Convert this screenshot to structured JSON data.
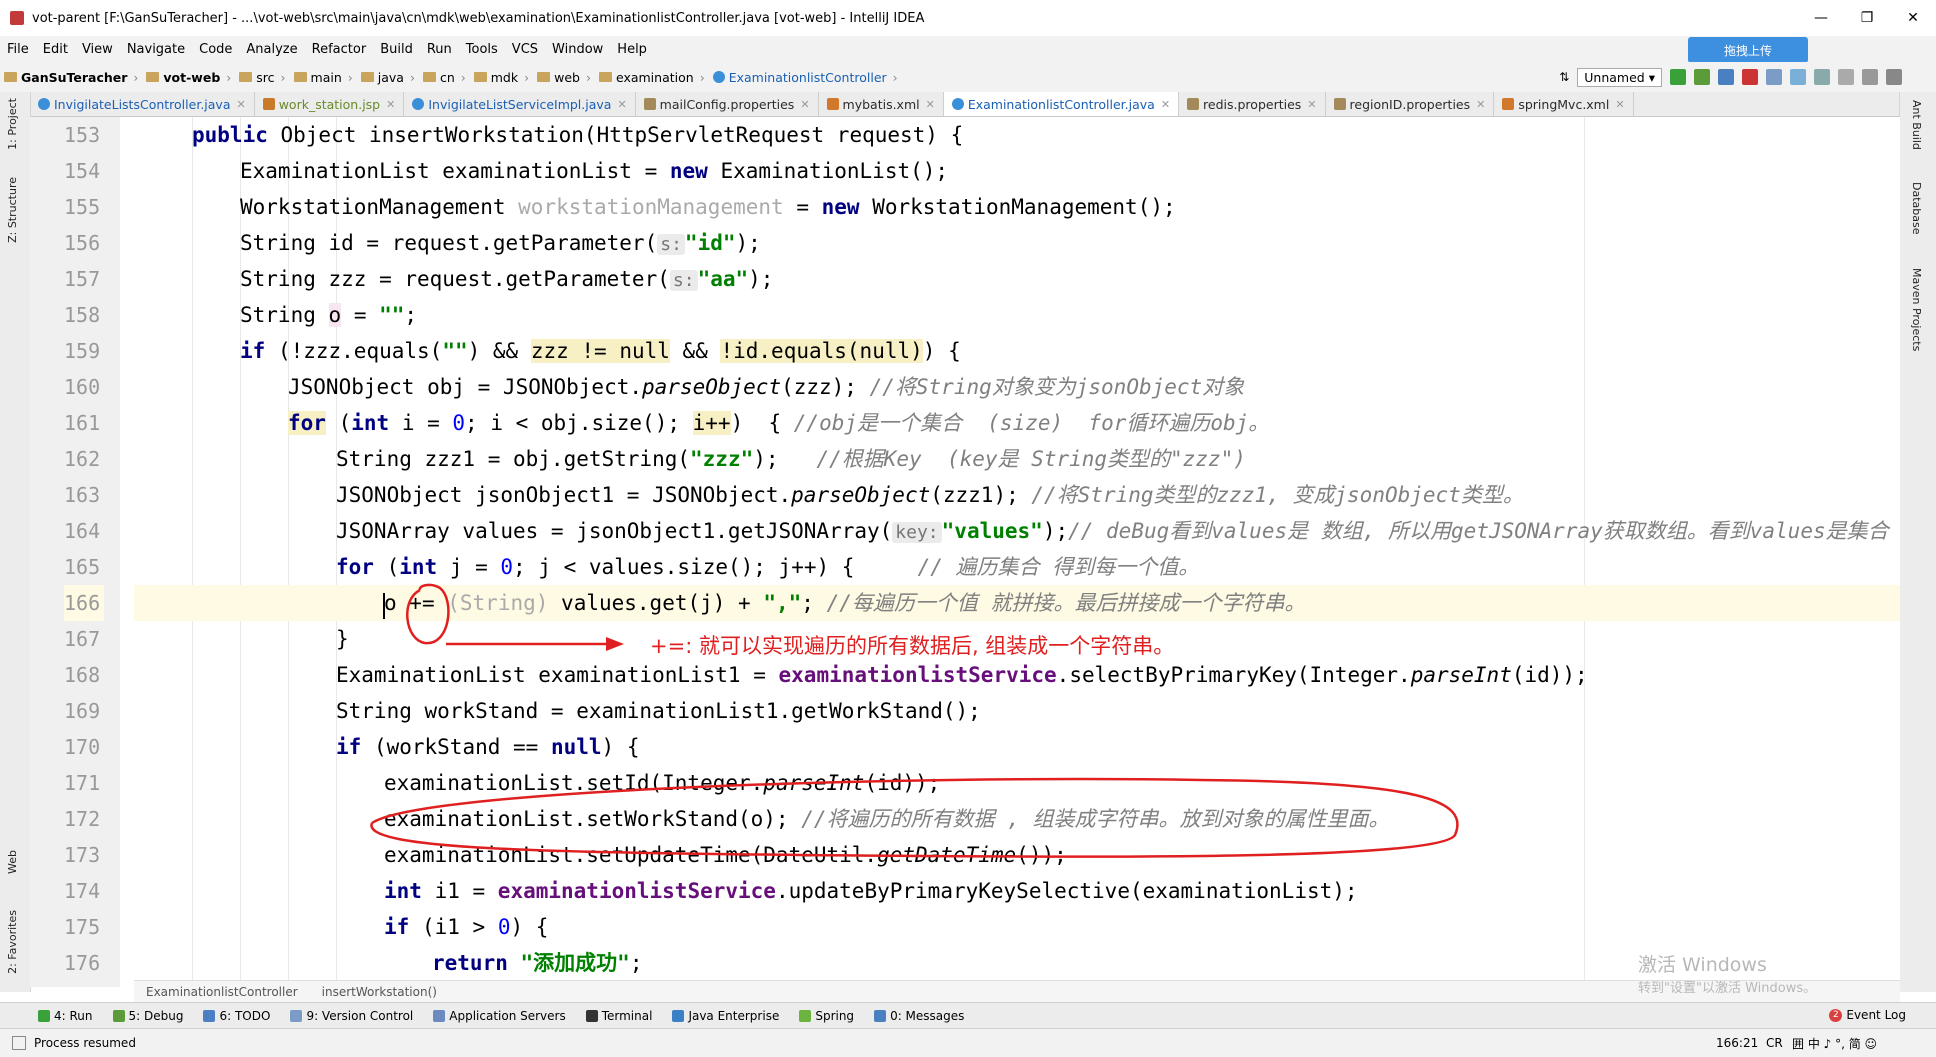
{
  "window": {
    "title": "vot-parent [F:\\GanSuTeracher] - ...\\vot-web\\src\\main\\java\\cn\\mdk\\web\\examination\\ExaminationlistController.java [vot-web] - IntelliJ IDEA",
    "min": "—",
    "max": "❐",
    "close": "✕"
  },
  "menu": [
    "File",
    "Edit",
    "View",
    "Navigate",
    "Code",
    "Analyze",
    "Refactor",
    "Build",
    "Run",
    "Tools",
    "VCS",
    "Window",
    "Help"
  ],
  "breadcrumbs": [
    "GanSuTeracher",
    "vot-web",
    "src",
    "main",
    "java",
    "cn",
    "mdk",
    "web",
    "examination",
    "ExaminationlistController"
  ],
  "run_config": "Unnamed",
  "upload_label": "拖拽上传",
  "tabs": [
    {
      "label": "InvigilateListsController.java",
      "active": false
    },
    {
      "label": "work_station.jsp",
      "active": false
    },
    {
      "label": "InvigilateListServiceImpl.java",
      "active": false
    },
    {
      "label": "mailConfig.properties",
      "active": false
    },
    {
      "label": "mybatis.xml",
      "active": false
    },
    {
      "label": "ExaminationlistController.java",
      "active": true
    },
    {
      "label": "redis.properties",
      "active": false
    },
    {
      "label": "regionID.properties",
      "active": false
    },
    {
      "label": "springMvc.xml",
      "active": false
    }
  ],
  "left_tools": [
    "1: Project",
    "Z: Structure",
    "Web",
    "2: Favorites"
  ],
  "right_tools": [
    "Ant Build",
    "Database",
    "Maven Projects"
  ],
  "code": {
    "line_numbers": [
      "153",
      "154",
      "155",
      "156",
      "157",
      "158",
      "159",
      "160",
      "161",
      "162",
      "163",
      "164",
      "165",
      "166",
      "167",
      "168",
      "169",
      "170",
      "171",
      "172",
      "173",
      "174",
      "175",
      "176"
    ],
    "l153": {
      "kw": "public",
      "rest": " Object insertWorkstation(HttpServletRequest request) {"
    },
    "l154": {
      "a": "ExaminationList examinationList = ",
      "kw": "new",
      "b": " ExaminationList();"
    },
    "l155": {
      "a": "WorkstationManagement ",
      "gray": "workstationManagement",
      "b": " = ",
      "kw": "new",
      "c": " WorkstationManagement();"
    },
    "l156": {
      "a": "String id = request.getParameter(",
      "hint": "s:",
      "str": "\"id\"",
      "b": ");"
    },
    "l157": {
      "a": "String zzz = request.getParameter(",
      "hint": "s:",
      "str": "\"aa\"",
      "b": ");"
    },
    "l158": {
      "a": "String ",
      "o": "o",
      "b": " = ",
      "str": "\"\"",
      "c": ";"
    },
    "l159": {
      "kw": "if",
      "a": " (!zzz.equals(",
      "str": "\"\"",
      "b": ") && ",
      "w1": "zzz != null",
      "c": " && ",
      "w2": "!id.equals(null)",
      "d": ") {"
    },
    "l160": {
      "a": "JSONObject obj = JSONObject.",
      "it": "parseObject",
      "b": "(zzz); ",
      "cm": "//将String对象变为jsonObject对象"
    },
    "l161": {
      "kw": "for",
      "a": " (",
      "kw2": "int",
      "b": " i = ",
      "n": "0",
      "c": "; i < obj.size(); ",
      "w": "i++",
      "d": ")  { ",
      "cm": "//obj是一个集合  (size)  for循环遍历obj。"
    },
    "l162": {
      "a": "String zzz1 = obj.getString(",
      "str": "\"zzz\"",
      "b": ");   ",
      "cm": "//根据Key  (key是 String类型的\"zzz\")"
    },
    "l163": {
      "a": "JSONObject jsonObject1 = JSONObject.",
      "it": "parseObject",
      "b": "(zzz1); ",
      "cm": "//将String类型的zzz1, 变成jsonObject类型。"
    },
    "l164": {
      "a": "JSONArray values = jsonObject1.getJSONArray(",
      "hint": "key:",
      "str": "\"values\"",
      "b": ");",
      "cm": "// deBug看到values是 数组, 所以用getJSONArray获取数组。看到values是集合"
    },
    "l165": {
      "kw": "for",
      "a": " (",
      "kw2": "int",
      "b": " j = ",
      "n": "0",
      "c": "; j < values.size(); j++) {     ",
      "cm": "// 遍历集合 得到每一个值。"
    },
    "l166": {
      "a": "o ",
      "op": "+=",
      "b": " ",
      "gray": "(String)",
      "c": " values.get(j) + ",
      "str": "\",\"",
      "d": "; ",
      "cm": "//每遍历一个值 就拼接。最后拼接成一个字符串。"
    },
    "l167": {
      "a": "}"
    },
    "l168": {
      "a": "ExaminationList examinationList1 = ",
      "fld": "examinationlistService",
      "b": ".selectByPrimaryKey(Integer.",
      "it": "parseInt",
      "c": "(id));"
    },
    "l169": {
      "a": "String workStand = examinationList1.getWorkStand();"
    },
    "l170": {
      "kw": "if",
      "a": " (workStand == ",
      "kw2": "null",
      "b": ") {"
    },
    "l171": {
      "a": "examinationList.setId(Integer.",
      "it": "parseInt",
      "b": "(id));"
    },
    "l172": {
      "a": "examinationList.setWorkStand(o); ",
      "cm": "//将遍历的所有数据 , 组装成字符串。放到对象的属性里面。"
    },
    "l173": {
      "a": "examinationList.setUpdateTime(DateUtil.",
      "it": "getDateTime",
      "b": "());"
    },
    "l174": {
      "kw": "int",
      "a": " i1 = ",
      "fld": "examinationlistService",
      "b": ".updateByPrimaryKeySelective(examinationList);"
    },
    "l175": {
      "kw": "if",
      "a": " (i1 > ",
      "n": "0",
      "b": ") {"
    },
    "l176": {
      "kw": "return",
      "a": " ",
      "str": "\"添加成功\"",
      "b": ";"
    }
  },
  "annotation_text": "+=: 就可以实现遍历的所有数据后, 组装成一个字符串。",
  "editor_breadcrumb": [
    "ExaminationlistController",
    "insertWorkstation()"
  ],
  "watermark": {
    "line1": "激活 Windows",
    "line2": "转到\"设置\"以激活 Windows。"
  },
  "tool_windows": [
    "4: Run",
    "5: Debug",
    "6: TODO",
    "9: Version Control",
    "Application Servers",
    "Terminal",
    "Java Enterprise",
    "Spring",
    "0: Messages"
  ],
  "event_log": {
    "count": "2",
    "label": "Event Log"
  },
  "status": {
    "message": "Process resumed",
    "position": "166:21",
    "crlf": "CR",
    "ime": "囲 中 ♪ °, 简 ☺"
  },
  "colors": {
    "annotation": "#e02020",
    "keyword": "#000080",
    "string": "#008000",
    "comment": "#808080",
    "field": "#660e7a"
  }
}
